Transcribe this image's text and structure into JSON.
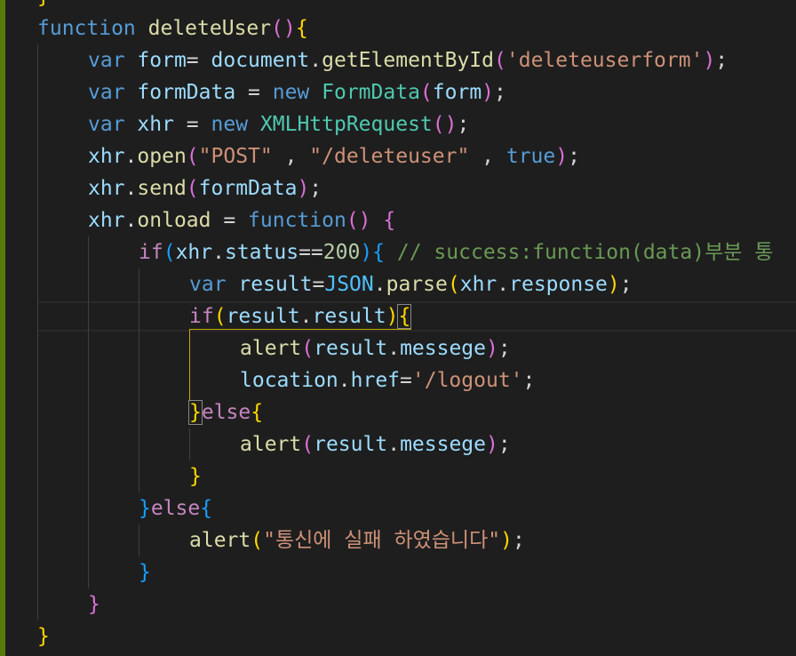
{
  "editor": {
    "language": "javascript",
    "theme_colors": {
      "background": "#1e1e1e",
      "keyword": "#569cd6",
      "control": "#c586c0",
      "function": "#dcdcaa",
      "variable": "#9cdcfe",
      "string": "#ce9178",
      "number": "#b5cea8",
      "comment": "#6a9955",
      "class": "#4ec9b0",
      "git_modified_bar": "#587c0c"
    },
    "lines": [
      {
        "indent": 0,
        "tokens": [
          {
            "t": "}",
            "c": "b1"
          }
        ]
      },
      {
        "indent": 0,
        "tokens": [
          {
            "t": "function",
            "c": "kw"
          },
          {
            "t": " ",
            "c": "p"
          },
          {
            "t": "deleteUser",
            "c": "fn"
          },
          {
            "t": "()",
            "c": "b2"
          },
          {
            "t": "{",
            "c": "b1"
          }
        ]
      },
      {
        "indent": 1,
        "tokens": [
          {
            "t": "var",
            "c": "kw"
          },
          {
            "t": " ",
            "c": "p"
          },
          {
            "t": "form",
            "c": "var"
          },
          {
            "t": "= ",
            "c": "p"
          },
          {
            "t": "document",
            "c": "var"
          },
          {
            "t": ".",
            "c": "p"
          },
          {
            "t": "getElementById",
            "c": "fn"
          },
          {
            "t": "(",
            "c": "b2"
          },
          {
            "t": "'deleteuserform'",
            "c": "str"
          },
          {
            "t": ")",
            "c": "b2"
          },
          {
            "t": ";",
            "c": "p"
          }
        ]
      },
      {
        "indent": 1,
        "tokens": [
          {
            "t": "var",
            "c": "kw"
          },
          {
            "t": " ",
            "c": "p"
          },
          {
            "t": "formData",
            "c": "var"
          },
          {
            "t": " = ",
            "c": "p"
          },
          {
            "t": "new",
            "c": "kw"
          },
          {
            "t": " ",
            "c": "p"
          },
          {
            "t": "FormData",
            "c": "cls"
          },
          {
            "t": "(",
            "c": "b2"
          },
          {
            "t": "form",
            "c": "var"
          },
          {
            "t": ")",
            "c": "b2"
          },
          {
            "t": ";",
            "c": "p"
          }
        ]
      },
      {
        "indent": 1,
        "tokens": [
          {
            "t": "var",
            "c": "kw"
          },
          {
            "t": " ",
            "c": "p"
          },
          {
            "t": "xhr",
            "c": "var"
          },
          {
            "t": " = ",
            "c": "p"
          },
          {
            "t": "new",
            "c": "kw"
          },
          {
            "t": " ",
            "c": "p"
          },
          {
            "t": "XMLHttpRequest",
            "c": "cls"
          },
          {
            "t": "()",
            "c": "b2"
          },
          {
            "t": ";",
            "c": "p"
          }
        ]
      },
      {
        "indent": 1,
        "tokens": [
          {
            "t": "xhr",
            "c": "var"
          },
          {
            "t": ".",
            "c": "p"
          },
          {
            "t": "open",
            "c": "fn"
          },
          {
            "t": "(",
            "c": "b2"
          },
          {
            "t": "\"POST\"",
            "c": "str"
          },
          {
            "t": " , ",
            "c": "p"
          },
          {
            "t": "\"/deleteuser\"",
            "c": "str"
          },
          {
            "t": " , ",
            "c": "p"
          },
          {
            "t": "true",
            "c": "kw"
          },
          {
            "t": ")",
            "c": "b2"
          },
          {
            "t": ";",
            "c": "p"
          }
        ]
      },
      {
        "indent": 1,
        "tokens": [
          {
            "t": "xhr",
            "c": "var"
          },
          {
            "t": ".",
            "c": "p"
          },
          {
            "t": "send",
            "c": "fn"
          },
          {
            "t": "(",
            "c": "b2"
          },
          {
            "t": "formData",
            "c": "var"
          },
          {
            "t": ")",
            "c": "b2"
          },
          {
            "t": ";",
            "c": "p"
          }
        ]
      },
      {
        "indent": 1,
        "tokens": [
          {
            "t": "xhr",
            "c": "var"
          },
          {
            "t": ".",
            "c": "p"
          },
          {
            "t": "onload",
            "c": "fn"
          },
          {
            "t": " = ",
            "c": "p"
          },
          {
            "t": "function",
            "c": "kw"
          },
          {
            "t": "()",
            "c": "b2"
          },
          {
            "t": " ",
            "c": "p"
          },
          {
            "t": "{",
            "c": "b2"
          }
        ]
      },
      {
        "indent": 2,
        "tokens": [
          {
            "t": "if",
            "c": "ctl"
          },
          {
            "t": "(",
            "c": "b3"
          },
          {
            "t": "xhr",
            "c": "var"
          },
          {
            "t": ".",
            "c": "p"
          },
          {
            "t": "status",
            "c": "var"
          },
          {
            "t": "==",
            "c": "p"
          },
          {
            "t": "200",
            "c": "num"
          },
          {
            "t": ")",
            "c": "b3"
          },
          {
            "t": "{",
            "c": "b3"
          },
          {
            "t": " ",
            "c": "p"
          },
          {
            "t": "// success:function(data)부분 통",
            "c": "cmt"
          }
        ]
      },
      {
        "indent": 3,
        "tokens": [
          {
            "t": "var",
            "c": "kw"
          },
          {
            "t": " ",
            "c": "p"
          },
          {
            "t": "result",
            "c": "var"
          },
          {
            "t": "=",
            "c": "p"
          },
          {
            "t": "JSON",
            "c": "const"
          },
          {
            "t": ".",
            "c": "p"
          },
          {
            "t": "parse",
            "c": "fn"
          },
          {
            "t": "(",
            "c": "b1"
          },
          {
            "t": "xhr",
            "c": "var"
          },
          {
            "t": ".",
            "c": "p"
          },
          {
            "t": "response",
            "c": "var"
          },
          {
            "t": ")",
            "c": "b1"
          },
          {
            "t": ";",
            "c": "p"
          }
        ]
      },
      {
        "indent": 3,
        "current": true,
        "tokens": [
          {
            "t": "if",
            "c": "ctl"
          },
          {
            "t": "(",
            "c": "b1"
          },
          {
            "t": "result",
            "c": "var"
          },
          {
            "t": ".",
            "c": "p"
          },
          {
            "t": "result",
            "c": "var"
          },
          {
            "t": ")",
            "c": "b1"
          },
          {
            "t": "{",
            "c": "b1",
            "match": true
          }
        ]
      },
      {
        "indent": 4,
        "tokens": [
          {
            "t": "alert",
            "c": "fn"
          },
          {
            "t": "(",
            "c": "b2"
          },
          {
            "t": "result",
            "c": "var"
          },
          {
            "t": ".",
            "c": "p"
          },
          {
            "t": "messege",
            "c": "var"
          },
          {
            "t": ")",
            "c": "b2"
          },
          {
            "t": ";",
            "c": "p"
          }
        ]
      },
      {
        "indent": 4,
        "tokens": [
          {
            "t": "location",
            "c": "var"
          },
          {
            "t": ".",
            "c": "p"
          },
          {
            "t": "href",
            "c": "var"
          },
          {
            "t": "=",
            "c": "p"
          },
          {
            "t": "'/logout'",
            "c": "str"
          },
          {
            "t": ";",
            "c": "p"
          }
        ]
      },
      {
        "indent": 3,
        "tokens": [
          {
            "t": "}",
            "c": "b1",
            "match": true
          },
          {
            "t": "else",
            "c": "ctl"
          },
          {
            "t": "{",
            "c": "b1"
          }
        ]
      },
      {
        "indent": 4,
        "tokens": [
          {
            "t": "alert",
            "c": "fn"
          },
          {
            "t": "(",
            "c": "b2"
          },
          {
            "t": "result",
            "c": "var"
          },
          {
            "t": ".",
            "c": "p"
          },
          {
            "t": "messege",
            "c": "var"
          },
          {
            "t": ")",
            "c": "b2"
          },
          {
            "t": ";",
            "c": "p"
          }
        ]
      },
      {
        "indent": 3,
        "tokens": [
          {
            "t": "}",
            "c": "b1"
          }
        ]
      },
      {
        "indent": 2,
        "tokens": [
          {
            "t": "}",
            "c": "b3"
          },
          {
            "t": "else",
            "c": "ctl"
          },
          {
            "t": "{",
            "c": "b3"
          }
        ]
      },
      {
        "indent": 3,
        "tokens": [
          {
            "t": "alert",
            "c": "fn"
          },
          {
            "t": "(",
            "c": "b1"
          },
          {
            "t": "\"통신에 실패 하였습니다\"",
            "c": "str"
          },
          {
            "t": ")",
            "c": "b1"
          },
          {
            "t": ";",
            "c": "p"
          }
        ]
      },
      {
        "indent": 2,
        "tokens": [
          {
            "t": "}",
            "c": "b3"
          }
        ]
      },
      {
        "indent": 1,
        "tokens": [
          {
            "t": "}",
            "c": "b2"
          }
        ]
      },
      {
        "indent": 0,
        "tokens": [
          {
            "t": "}",
            "c": "b1"
          }
        ]
      }
    ]
  }
}
